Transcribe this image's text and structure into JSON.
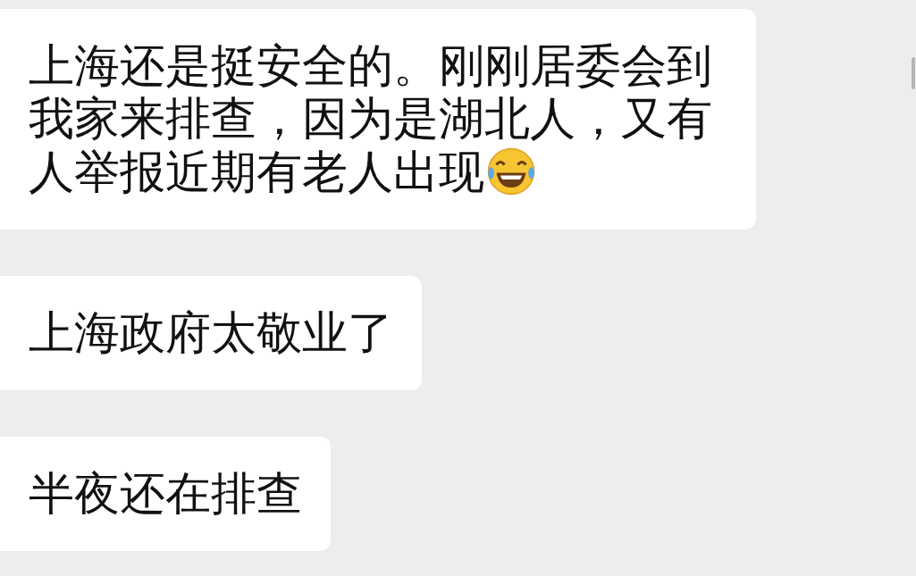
{
  "messages": [
    {
      "text": "上海还是挺安全的。刚刚居委会到我家来排查，因为是湖北人，又有人举报近期有老人出现",
      "laughing_emoji": true
    },
    {
      "text": "上海政府太敬业了",
      "laughing_emoji": false
    },
    {
      "text": "半夜还在排查",
      "laughing_emoji": false
    }
  ]
}
